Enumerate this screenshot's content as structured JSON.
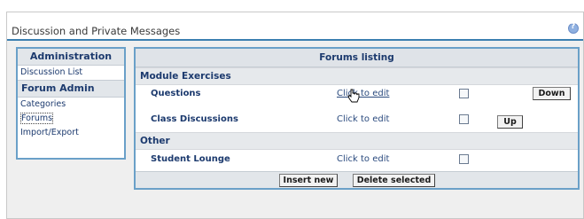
{
  "page": {
    "title": "Discussion and Private Messages",
    "help_icon": "help-icon"
  },
  "sidebar": {
    "admin_header": "Administration",
    "discussion_list": "Discussion List",
    "forum_admin_header": "Forum Admin",
    "items": [
      {
        "label": "Categories"
      },
      {
        "label": "Forums",
        "selected": true
      },
      {
        "label": "Import/Export"
      }
    ]
  },
  "listing": {
    "header": "Forums listing",
    "sections": [
      {
        "name": "Module Exercises",
        "forums": [
          {
            "name": "Questions",
            "edit_label": "Click to edit",
            "button": "Down"
          },
          {
            "name": "Class Discussions",
            "edit_label": "Click to edit",
            "button": "Up"
          }
        ]
      },
      {
        "name": "Other",
        "forums": [
          {
            "name": "Student Lounge",
            "edit_label": "Click to edit"
          }
        ]
      }
    ],
    "insert_button": "Insert new",
    "delete_button": "Delete selected"
  },
  "colors": {
    "accent_border": "#6aa0c8",
    "header_rule": "#3b7fb0",
    "text_navy": "#1c3a6e"
  }
}
